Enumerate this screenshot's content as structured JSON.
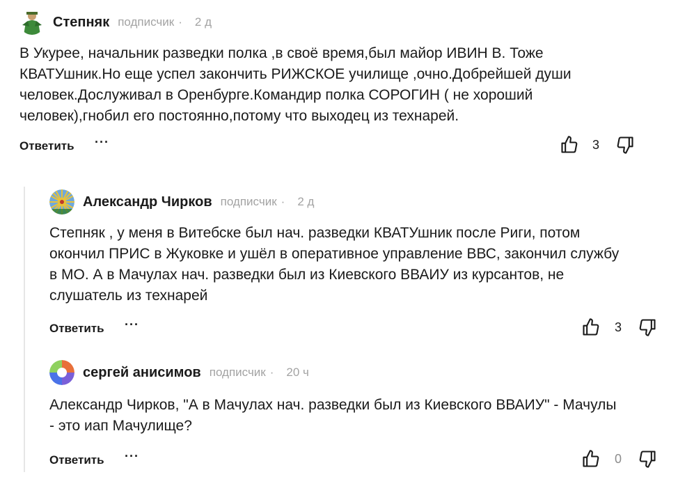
{
  "comments": [
    {
      "author": "Степняк",
      "role": "подписчик",
      "dot": "·",
      "time": "2 д",
      "text_lines": [
        "В Укурее, начальник разведки полка ,в своё время,был майор ИВИН В. Тоже",
        "КВАТУшник.Но еще успел закончить РИЖСКОЕ училище ,очно.Добрейшей души",
        "человек.Дослуживал в Оренбурге.Командир полка СОРОГИН ( не хороший",
        "человек),гнобил его постоянно,потому что выходец из технарей."
      ],
      "reply_label": "Ответить",
      "more_label": "···",
      "likes": "3"
    },
    {
      "author": "Александр Чирков",
      "role": "подписчик",
      "dot": "·",
      "time": "2 д",
      "text_lines": [
        "Степняк , у меня в Витебске был нач. разведки КВАТУшник после Риги, потом",
        "окончил ПРИС в Жуковке и ушёл в оперативное управление ВВС, закончил службу",
        "в МО. А в Мачулах нач. разведки был из Киевского ВВАИУ из курсантов, не",
        "слушатель из технарей"
      ],
      "reply_label": "Ответить",
      "more_label": "···",
      "likes": "3"
    },
    {
      "author": "сергей анисимов",
      "role": "подписчик",
      "dot": "·",
      "time": "20 ч",
      "text_lines": [
        "Александр Чирков, \"А в Мачулах нач. разведки был из Киевского ВВАИУ\" - Мачулы",
        "-  это иап Мачулище?"
      ],
      "reply_label": "Ответить",
      "more_label": "···",
      "likes": "0"
    }
  ],
  "colors": {
    "text": "#1a1a1a",
    "muted": "#a3a3a3",
    "thread_line": "#e6e6e6"
  },
  "icons": [
    "thumbs-up-icon",
    "thumbs-down-icon",
    "more-icon"
  ]
}
